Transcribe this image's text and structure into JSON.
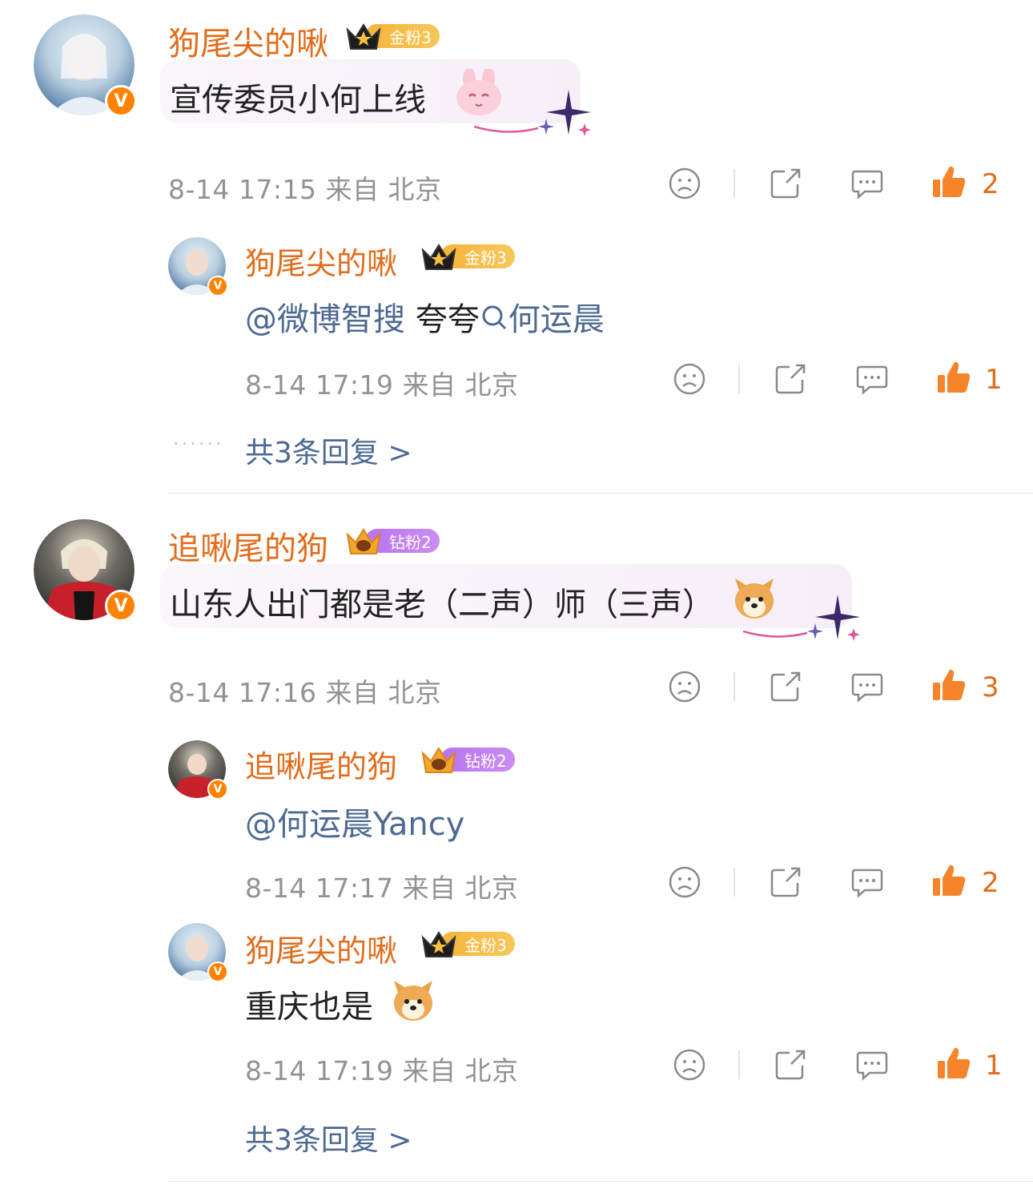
{
  "comments": [
    {
      "username": "狗尾尖的啾",
      "badge": "金粉3",
      "text": "宣传委员小何上线",
      "meta": "8-14 17:15 来自 北京",
      "likes": "2",
      "replies": [
        {
          "username": "狗尾尖的啾",
          "badge": "金粉3",
          "mention": "@微博智搜",
          "text_mid": "夸夸",
          "search_term": "何运晨",
          "meta": "8-14 17:19 来自 北京",
          "likes": "1"
        }
      ],
      "more_replies": "共3条回复 >"
    },
    {
      "username": "追啾尾的狗",
      "badge": "钻粉2",
      "text": "山东人出门都是老（二声）师（三声）",
      "meta": "8-14 17:16 来自 北京",
      "likes": "3",
      "replies": [
        {
          "username": "追啾尾的狗",
          "badge": "钻粉2",
          "mention": "@何运晨Yancy",
          "meta": "8-14 17:17 来自 北京",
          "likes": "2"
        },
        {
          "username": "狗尾尖的啾",
          "badge": "金粉3",
          "text": "重庆也是",
          "meta": "8-14 17:19 来自 北京",
          "likes": "1"
        }
      ],
      "more_replies": "共3条回复 >"
    }
  ],
  "colors": {
    "username": "#e26c1b",
    "link": "#4e6a93",
    "meta": "#939393",
    "like": "#f5842a",
    "verified": "#ff8200"
  },
  "icons": [
    "verified-icon",
    "crown-icon",
    "dislike-icon",
    "share-icon",
    "comment-icon",
    "like-icon",
    "search-icon",
    "bunny-emoji",
    "dog-emoji",
    "sparkle-decoration"
  ]
}
